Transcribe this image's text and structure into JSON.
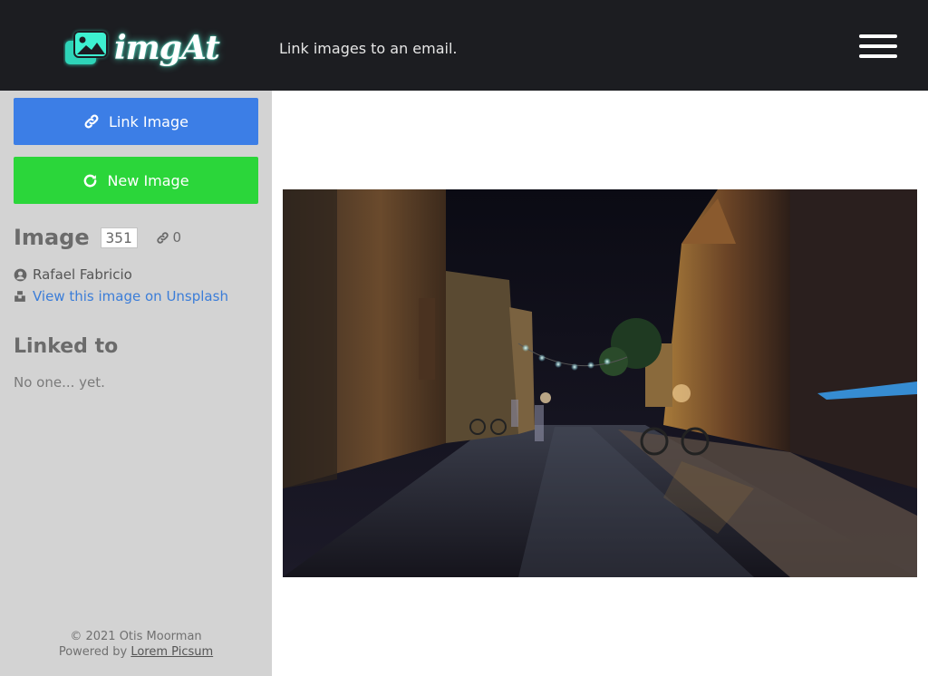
{
  "header": {
    "logo_text": "imgAt",
    "tagline": "Link images to an email.",
    "menu_icon": "hamburger-menu-icon",
    "background_color": "#1c1d21",
    "logo_glow_color": "#5affdc"
  },
  "sidebar": {
    "background_color": "#d3d3d3",
    "link_button": {
      "label": "Link Image",
      "icon": "link-icon",
      "color": "#3c7ee6"
    },
    "new_button": {
      "label": "New Image",
      "icon": "refresh-icon",
      "color": "#2bd63a"
    },
    "image": {
      "label": "Image",
      "id": "351",
      "link_count": "0"
    },
    "author": {
      "name": "Rafael Fabricio",
      "icon": "user-circle-icon"
    },
    "unsplash": {
      "link_text": "View this image on Unsplash",
      "icon": "unsplash-icon"
    },
    "linked": {
      "title": "Linked to",
      "empty_text": "No one... yet."
    },
    "footer": {
      "copyright": "© 2021 Otis Moorman",
      "powered_by": "Powered by",
      "powered_link": "Lorem Picsum"
    }
  },
  "main": {
    "photo": {
      "subject": "night street photo"
    }
  }
}
